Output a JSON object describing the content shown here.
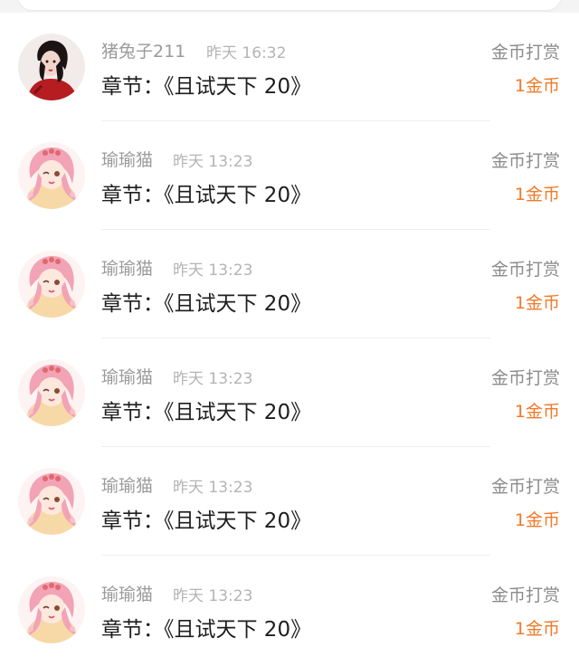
{
  "records": [
    {
      "name": "猪兔子211",
      "time": "昨天 16:32",
      "chapter": "章节：《且试天下 20》",
      "type": "金币打赏",
      "amount": "1金币",
      "avatar": "avatar-red-dress"
    },
    {
      "name": "瑜瑜猫",
      "time": "昨天 13:23",
      "chapter": "章节：《且试天下 20》",
      "type": "金币打赏",
      "amount": "1金币",
      "avatar": "avatar-anime-girl"
    },
    {
      "name": "瑜瑜猫",
      "time": "昨天 13:23",
      "chapter": "章节：《且试天下 20》",
      "type": "金币打赏",
      "amount": "1金币",
      "avatar": "avatar-anime-girl"
    },
    {
      "name": "瑜瑜猫",
      "time": "昨天 13:23",
      "chapter": "章节：《且试天下 20》",
      "type": "金币打赏",
      "amount": "1金币",
      "avatar": "avatar-anime-girl"
    },
    {
      "name": "瑜瑜猫",
      "time": "昨天 13:23",
      "chapter": "章节：《且试天下 20》",
      "type": "金币打赏",
      "amount": "1金币",
      "avatar": "avatar-anime-girl"
    },
    {
      "name": "瑜瑜猫",
      "time": "昨天 13:23",
      "chapter": "章节：《且试天下 20》",
      "type": "金币打赏",
      "amount": "1金币",
      "avatar": "avatar-anime-girl"
    }
  ],
  "colors": {
    "amount": "#f07a28",
    "name": "#9a9a9a",
    "chapter": "#1e1e1e"
  }
}
